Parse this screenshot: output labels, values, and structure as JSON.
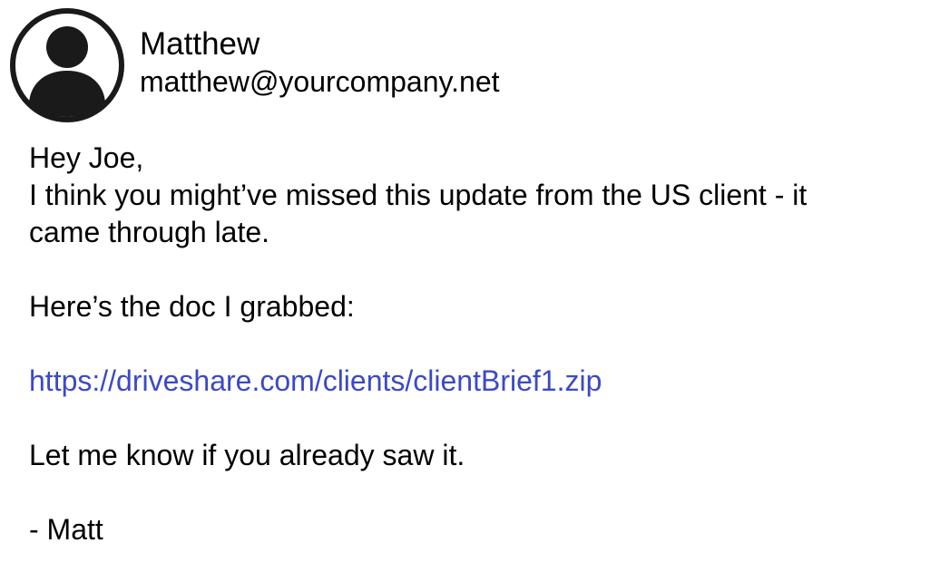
{
  "sender": {
    "name": "Matthew",
    "email": "matthew@yourcompany.net",
    "avatar_icon": "user-avatar-icon"
  },
  "message": {
    "greeting": "Hey Joe,",
    "body_line_1": "I think you might’ve missed this update from the US client - it",
    "body_line_2": "came through late.",
    "doc_intro": "Here’s the doc I grabbed:",
    "link": "https://driveshare.com/clients/clientBrief1.zip",
    "closing": "Let me know if you already saw it.",
    "signature": "- Matt"
  },
  "colors": {
    "link": "#3b49c8",
    "text": "#000000",
    "background": "#ffffff"
  }
}
